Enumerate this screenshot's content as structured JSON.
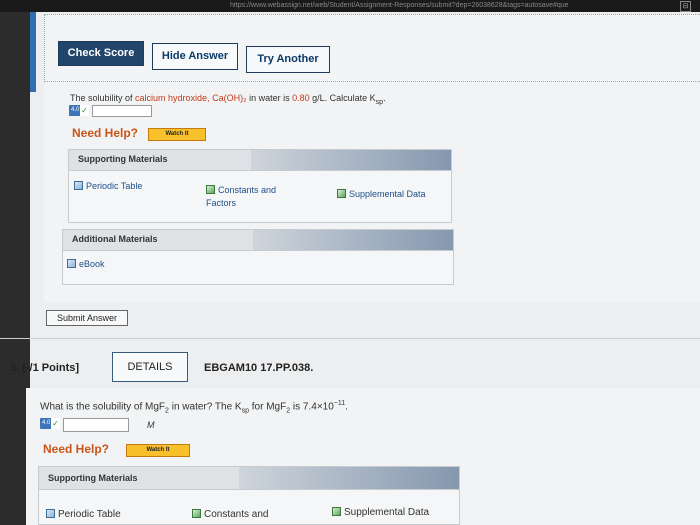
{
  "browser": {
    "url": "https://www.webassign.net/web/Student/Assignment-Responses/submit?dep=26038628&tags=autosave#que"
  },
  "toolbar": {
    "check_score": "Check Score",
    "hide_answer": "Hide Answer",
    "try_another": "Try Another"
  },
  "q4": {
    "text_prefix": "The solubility of ",
    "compound": "calcium hydroxide, Ca(OH)₂",
    "text_mid": " in water is ",
    "value": "0.80",
    "text_suffix": " g/L. Calculate K",
    "k_sub": "sp",
    "text_end": ".",
    "badge_num": "4.0",
    "need_help": "Need Help?",
    "watch": "Watch It",
    "supporting_title": "Supporting Materials",
    "supporting_links": [
      "Periodic Table",
      "Constants and Factors",
      "Supplemental Data"
    ],
    "additional_title": "Additional Materials",
    "additional_links": [
      "eBook"
    ],
    "submit": "Submit Answer"
  },
  "q5": {
    "number": "5.  [-/1 Points]",
    "details": "DETAILS",
    "code": "EBGAM10 17.PP.038.",
    "text_prefix": "What is the solubility of MgF",
    "f_sub": "2",
    "text_mid": " in water? The K",
    "k_sub": "sp",
    "text_mid2": " for MgF",
    "f_sub2": "2",
    "text_mid3": " is 7.4×10",
    "exp": "−11",
    "text_end": ".",
    "badge_num": "4.0",
    "unit": "M",
    "need_help": "Need Help?",
    "watch": "Watch It",
    "supporting_title": "Supporting Materials",
    "supporting_links": [
      "Periodic Table",
      "Constants and",
      "Supplemental Data"
    ]
  }
}
